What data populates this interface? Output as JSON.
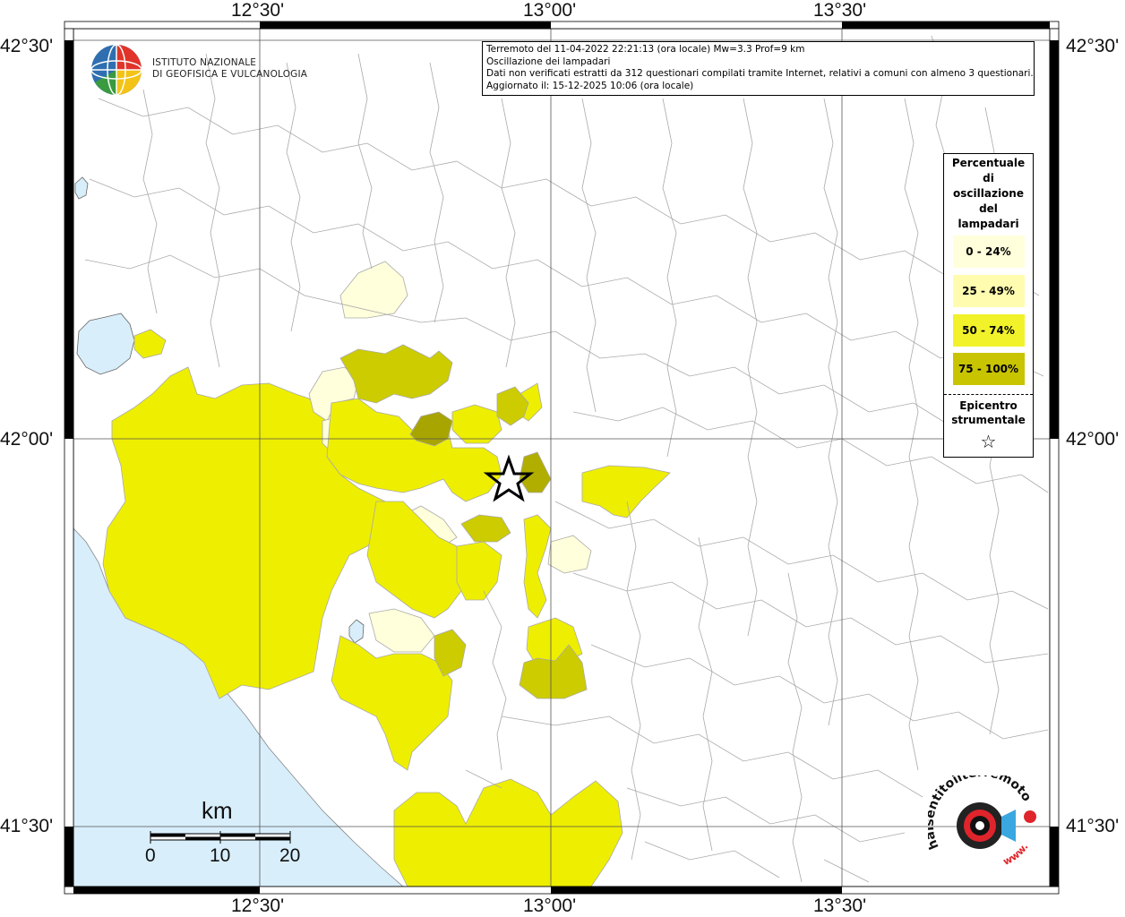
{
  "coordinates": {
    "lon_top": [
      "12°30'",
      "13°00'",
      "13°30'"
    ],
    "lon_bottom": [
      "12°30'",
      "13°00'",
      "13°30'"
    ],
    "lat_left": [
      "42°30'",
      "42°00'",
      "41°30'"
    ],
    "lat_right": [
      "42°30'",
      "42°00'",
      "41°30'"
    ]
  },
  "info": {
    "line1": "Terremoto del 11-04-2022 22:21:13 (ora locale) Mw=3.3 Prof=9 km",
    "line2": "Oscillazione dei lampadari",
    "line3": "Dati non verificati estratti da 312 questionari compilati tramite Internet, relativi a comuni con almeno 3 questionari.",
    "line4": "Aggiornato il: 15-12-2025 10:06 (ora locale)"
  },
  "logo": {
    "line1": "ISTITUTO NAZIONALE",
    "line2": "DI GEOFISICA E VULCANOLOGIA"
  },
  "legend": {
    "title_lines": [
      "Percentuale",
      "di",
      "oscillazione",
      "del",
      "lampadari"
    ],
    "items": [
      {
        "label": "0 - 24%",
        "color": "#ffffdb"
      },
      {
        "label": "25 - 49%",
        "color": "#fffcb0"
      },
      {
        "label": "50 - 74%",
        "color": "#f2f22a"
      },
      {
        "label": "75 - 100%",
        "color": "#c8c400"
      }
    ],
    "epicentre_lines": [
      "Epicentro",
      "strumentale"
    ],
    "epicentre_symbol": "☆"
  },
  "scale": {
    "unit": "km",
    "labels": [
      "0",
      "10",
      "20"
    ]
  },
  "colors": {
    "sea": "#d8eefb",
    "class1": "#ffffdb",
    "class2": "#fffcb0",
    "class3": "#eeee00",
    "class4": "#cccc00",
    "class4_dark": "#a8a400",
    "boundary": "#aaaaaa"
  },
  "watermark": {
    "text": "haisentitoilterremoto.it",
    "url": "www."
  }
}
